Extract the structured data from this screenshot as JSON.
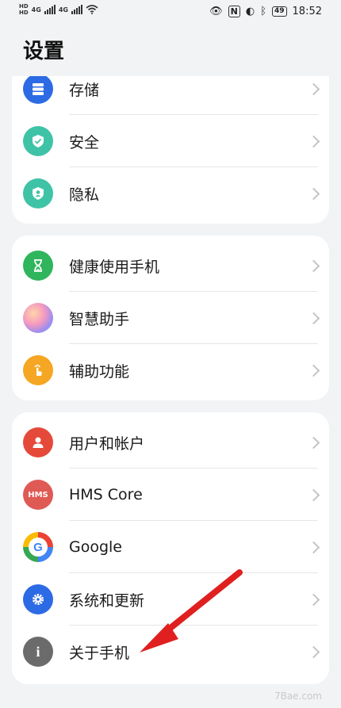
{
  "status_bar": {
    "left_top": "HD",
    "left_bottom": "HD",
    "net1": "4G",
    "net2": "4G",
    "time": "18:52",
    "battery": "49"
  },
  "page": {
    "title": "设置"
  },
  "groups": [
    {
      "items": [
        {
          "label": "存储",
          "icon": "storage-icon",
          "color": "#2d6be4"
        },
        {
          "label": "安全",
          "icon": "shield-icon",
          "color": "#3fc3a6"
        },
        {
          "label": "隐私",
          "icon": "privacy-icon",
          "color": "#3fc3a6"
        }
      ]
    },
    {
      "items": [
        {
          "label": "健康使用手机",
          "icon": "hourglass-icon",
          "color": "#2fb55c"
        },
        {
          "label": "智慧助手",
          "icon": "assistant-orb-icon",
          "color": "#c89ee8"
        },
        {
          "label": "辅助功能",
          "icon": "hand-icon",
          "color": "#f5a623"
        }
      ]
    },
    {
      "items": [
        {
          "label": "用户和帐户",
          "icon": "user-icon",
          "color": "#e5493a"
        },
        {
          "label": "HMS Core",
          "icon": "hms-icon",
          "icon_text": "HMS",
          "color": "#e05a55"
        },
        {
          "label": "Google",
          "icon": "google-icon",
          "icon_text": "G",
          "color": "#4285f4"
        },
        {
          "label": "系统和更新",
          "icon": "gear-icon",
          "color": "#2d6be4"
        },
        {
          "label": "关于手机",
          "icon": "info-icon",
          "icon_text": "i",
          "color": "#6b6b6b"
        }
      ]
    }
  ],
  "annotation": {
    "color": "#e02020"
  },
  "watermark": "7Bae.com"
}
